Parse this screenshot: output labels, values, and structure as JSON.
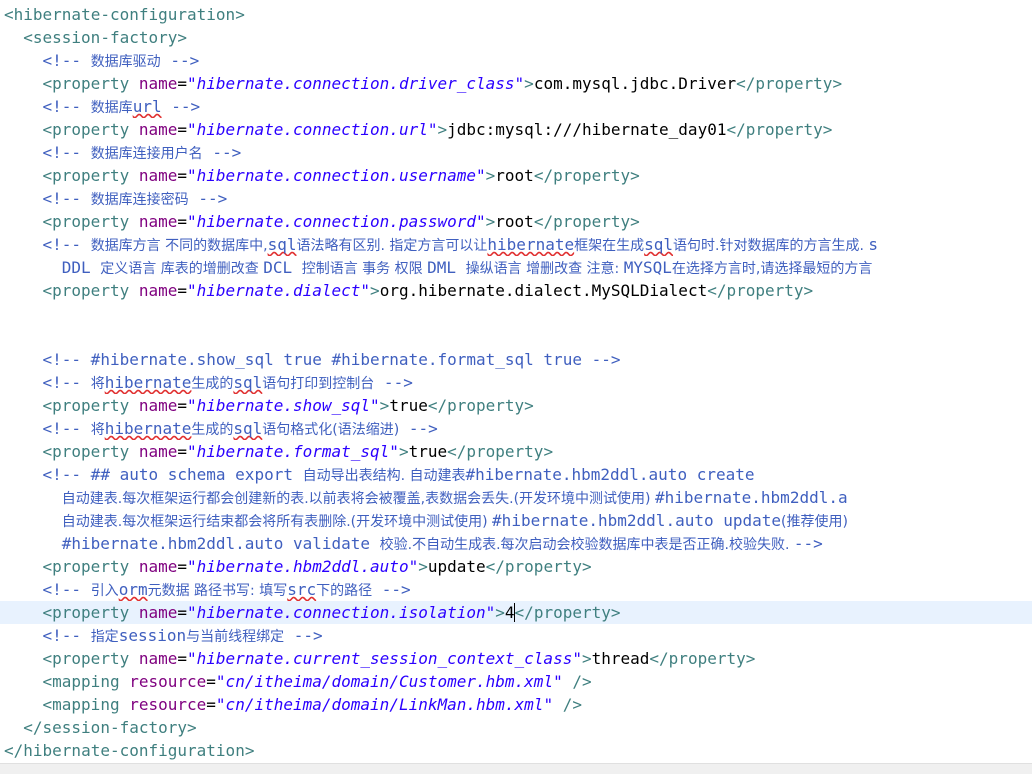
{
  "lines": [
    {
      "indent": 0,
      "parts": [
        {
          "c": "t",
          "x": "<hibernate-configuration>"
        }
      ]
    },
    {
      "indent": 2,
      "parts": [
        {
          "c": "t",
          "x": "<session-factory>"
        }
      ]
    },
    {
      "indent": 4,
      "parts": [
        {
          "c": "c",
          "x": "<!-- "
        },
        {
          "c": "c cz",
          "x": "数据库驱动"
        },
        {
          "c": "c",
          "x": " -->"
        }
      ]
    },
    {
      "indent": 4,
      "parts": [
        {
          "c": "t",
          "x": "<property "
        },
        {
          "c": "a",
          "x": "name"
        },
        {
          "c": "",
          "x": "="
        },
        {
          "c": "v",
          "x": "\"hibernate.connection.driver_class\""
        },
        {
          "c": "t",
          "x": ">"
        },
        {
          "c": "",
          "x": "com.mysql.jdbc.Driver"
        },
        {
          "c": "t",
          "x": "</property>"
        }
      ]
    },
    {
      "indent": 4,
      "parts": [
        {
          "c": "c",
          "x": "<!-- "
        },
        {
          "c": "c cz",
          "x": "数据库"
        },
        {
          "c": "c sq",
          "x": "url"
        },
        {
          "c": "c",
          "x": " -->"
        }
      ]
    },
    {
      "indent": 4,
      "parts": [
        {
          "c": "t",
          "x": "<property "
        },
        {
          "c": "a",
          "x": "name"
        },
        {
          "c": "",
          "x": "="
        },
        {
          "c": "v",
          "x": "\"hibernate.connection.url\""
        },
        {
          "c": "t",
          "x": ">"
        },
        {
          "c": "",
          "x": "jdbc:mysql:///hibernate_day01"
        },
        {
          "c": "t",
          "x": "</property>"
        }
      ]
    },
    {
      "indent": 4,
      "parts": [
        {
          "c": "c",
          "x": "<!-- "
        },
        {
          "c": "c cz",
          "x": "数据库连接用户名"
        },
        {
          "c": "c",
          "x": " -->"
        }
      ]
    },
    {
      "indent": 4,
      "parts": [
        {
          "c": "t",
          "x": "<property "
        },
        {
          "c": "a",
          "x": "name"
        },
        {
          "c": "",
          "x": "="
        },
        {
          "c": "v",
          "x": "\"hibernate.connection.username\""
        },
        {
          "c": "t",
          "x": ">"
        },
        {
          "c": "",
          "x": "root"
        },
        {
          "c": "t",
          "x": "</property>"
        }
      ]
    },
    {
      "indent": 4,
      "parts": [
        {
          "c": "c",
          "x": "<!-- "
        },
        {
          "c": "c cz",
          "x": "数据库连接密码"
        },
        {
          "c": "c",
          "x": " -->"
        }
      ]
    },
    {
      "indent": 4,
      "parts": [
        {
          "c": "t",
          "x": "<property "
        },
        {
          "c": "a",
          "x": "name"
        },
        {
          "c": "",
          "x": "="
        },
        {
          "c": "v",
          "x": "\"hibernate.connection.password\""
        },
        {
          "c": "t",
          "x": ">"
        },
        {
          "c": "",
          "x": "root"
        },
        {
          "c": "t",
          "x": "</property>"
        }
      ]
    },
    {
      "indent": 4,
      "parts": [
        {
          "c": "c",
          "x": "<!-- "
        },
        {
          "c": "c cz",
          "x": "数据库方言 不同的数据库中,"
        },
        {
          "c": "c sq",
          "x": "sql"
        },
        {
          "c": "c cz",
          "x": "语法略有区别. 指定方言可以让"
        },
        {
          "c": "c sq",
          "x": "hibernate"
        },
        {
          "c": "c cz",
          "x": "框架在生成"
        },
        {
          "c": "c sq",
          "x": "sql"
        },
        {
          "c": "c cz",
          "x": "语句时.针对数据库的方言生成. "
        },
        {
          "c": "c",
          "x": "s"
        }
      ]
    },
    {
      "indent": 6,
      "parts": [
        {
          "c": "c",
          "x": "DDL "
        },
        {
          "c": "c cz",
          "x": "定义语言 库表的增删改查 "
        },
        {
          "c": "c",
          "x": "DCL "
        },
        {
          "c": "c cz",
          "x": "控制语言 事务 权限 "
        },
        {
          "c": "c",
          "x": "DML "
        },
        {
          "c": "c cz",
          "x": "操纵语言 增删改查 注意: "
        },
        {
          "c": "c",
          "x": "MYSQL"
        },
        {
          "c": "c cz",
          "x": "在选择方言时,请选择最短的方言"
        }
      ]
    },
    {
      "indent": 4,
      "parts": [
        {
          "c": "t",
          "x": "<property "
        },
        {
          "c": "a",
          "x": "name"
        },
        {
          "c": "",
          "x": "="
        },
        {
          "c": "v",
          "x": "\"hibernate.dialect\""
        },
        {
          "c": "t",
          "x": ">"
        },
        {
          "c": "",
          "x": "org.hibernate.dialect.MySQLDialect"
        },
        {
          "c": "t",
          "x": "</property>"
        }
      ]
    },
    {
      "indent": 0,
      "parts": []
    },
    {
      "indent": 0,
      "parts": []
    },
    {
      "indent": 4,
      "parts": [
        {
          "c": "c",
          "x": "<!-- #hibernate.show_sql true #hibernate.format_sql true -->"
        }
      ]
    },
    {
      "indent": 4,
      "parts": [
        {
          "c": "c",
          "x": "<!-- "
        },
        {
          "c": "c cz",
          "x": "将"
        },
        {
          "c": "c sq",
          "x": "hibernate"
        },
        {
          "c": "c cz",
          "x": "生成的"
        },
        {
          "c": "c sq",
          "x": "sql"
        },
        {
          "c": "c cz",
          "x": "语句打印到控制台"
        },
        {
          "c": "c",
          "x": " -->"
        }
      ]
    },
    {
      "indent": 4,
      "parts": [
        {
          "c": "t",
          "x": "<property "
        },
        {
          "c": "a",
          "x": "name"
        },
        {
          "c": "",
          "x": "="
        },
        {
          "c": "v",
          "x": "\"hibernate.show_sql\""
        },
        {
          "c": "t",
          "x": ">"
        },
        {
          "c": "",
          "x": "true"
        },
        {
          "c": "t",
          "x": "</property>"
        }
      ]
    },
    {
      "indent": 4,
      "parts": [
        {
          "c": "c",
          "x": "<!-- "
        },
        {
          "c": "c cz",
          "x": "将"
        },
        {
          "c": "c sq",
          "x": "hibernate"
        },
        {
          "c": "c cz",
          "x": "生成的"
        },
        {
          "c": "c sq",
          "x": "sql"
        },
        {
          "c": "c cz",
          "x": "语句格式化(语法缩进)"
        },
        {
          "c": "c",
          "x": " -->"
        }
      ]
    },
    {
      "indent": 4,
      "parts": [
        {
          "c": "t",
          "x": "<property "
        },
        {
          "c": "a",
          "x": "name"
        },
        {
          "c": "",
          "x": "="
        },
        {
          "c": "v",
          "x": "\"hibernate.format_sql\""
        },
        {
          "c": "t",
          "x": ">"
        },
        {
          "c": "",
          "x": "true"
        },
        {
          "c": "t",
          "x": "</property>"
        }
      ]
    },
    {
      "indent": 4,
      "parts": [
        {
          "c": "c",
          "x": "<!-- ## auto schema export "
        },
        {
          "c": "c cz",
          "x": "自动导出表结构. 自动建表"
        },
        {
          "c": "c",
          "x": "#hibernate.hbm2ddl.auto create"
        }
      ]
    },
    {
      "indent": 6,
      "parts": [
        {
          "c": "c cz",
          "x": "自动建表.每次框架运行都会创建新的表.以前表将会被覆盖,表数据会丢失.(开发环境中测试使用) "
        },
        {
          "c": "c",
          "x": "#hibernate.hbm2ddl.a"
        }
      ]
    },
    {
      "indent": 6,
      "parts": [
        {
          "c": "c cz",
          "x": "自动建表.每次框架运行结束都会将所有表删除.(开发环境中测试使用) "
        },
        {
          "c": "c",
          "x": "#hibernate.hbm2ddl.auto update"
        },
        {
          "c": "c cz",
          "x": "(推荐使用)"
        }
      ]
    },
    {
      "indent": 6,
      "parts": [
        {
          "c": "c",
          "x": "#hibernate.hbm2ddl.auto validate "
        },
        {
          "c": "c cz",
          "x": "校验.不自动生成表.每次启动会校验数据库中表是否正确.校验失败. "
        },
        {
          "c": "c",
          "x": "-->"
        }
      ]
    },
    {
      "indent": 4,
      "parts": [
        {
          "c": "t",
          "x": "<property "
        },
        {
          "c": "a",
          "x": "name"
        },
        {
          "c": "",
          "x": "="
        },
        {
          "c": "v",
          "x": "\"hibernate.hbm2ddl.auto\""
        },
        {
          "c": "t",
          "x": ">"
        },
        {
          "c": "",
          "x": "update"
        },
        {
          "c": "t",
          "x": "</property>"
        }
      ]
    },
    {
      "indent": 4,
      "parts": [
        {
          "c": "c",
          "x": "<!-- "
        },
        {
          "c": "c cz",
          "x": "引入"
        },
        {
          "c": "c sq",
          "x": "orm"
        },
        {
          "c": "c cz",
          "x": "元数据 路径书写: 填写"
        },
        {
          "c": "c sq",
          "x": "src"
        },
        {
          "c": "c cz",
          "x": "下的路径"
        },
        {
          "c": "c",
          "x": " -->"
        }
      ]
    },
    {
      "indent": 4,
      "current": true,
      "parts": [
        {
          "c": "t",
          "x": "<property "
        },
        {
          "c": "a",
          "x": "name"
        },
        {
          "c": "",
          "x": "="
        },
        {
          "c": "v",
          "x": "\"hibernate.connection.isolation\""
        },
        {
          "c": "t",
          "x": ">"
        },
        {
          "c": "",
          "x": "4"
        },
        {
          "c": "t caret",
          "x": "</property>"
        }
      ]
    },
    {
      "indent": 4,
      "parts": [
        {
          "c": "c",
          "x": "<!-- "
        },
        {
          "c": "c cz",
          "x": "指定"
        },
        {
          "c": "c",
          "x": "session"
        },
        {
          "c": "c cz",
          "x": "与当前线程绑定"
        },
        {
          "c": "c",
          "x": " -->"
        }
      ]
    },
    {
      "indent": 4,
      "parts": [
        {
          "c": "t",
          "x": "<property "
        },
        {
          "c": "a",
          "x": "name"
        },
        {
          "c": "",
          "x": "="
        },
        {
          "c": "v",
          "x": "\"hibernate.current_session_context_class\""
        },
        {
          "c": "t",
          "x": ">"
        },
        {
          "c": "",
          "x": "thread"
        },
        {
          "c": "t",
          "x": "</property>"
        }
      ]
    },
    {
      "indent": 4,
      "parts": [
        {
          "c": "t",
          "x": "<mapping "
        },
        {
          "c": "a",
          "x": "resource"
        },
        {
          "c": "",
          "x": "="
        },
        {
          "c": "v",
          "x": "\"cn/itheima/domain/Customer.hbm.xml\""
        },
        {
          "c": "t",
          "x": " />"
        }
      ]
    },
    {
      "indent": 4,
      "parts": [
        {
          "c": "t",
          "x": "<mapping "
        },
        {
          "c": "a",
          "x": "resource"
        },
        {
          "c": "",
          "x": "="
        },
        {
          "c": "v",
          "x": "\"cn/itheima/domain/LinkMan.hbm.xml\""
        },
        {
          "c": "t",
          "x": " />"
        }
      ]
    },
    {
      "indent": 2,
      "parts": [
        {
          "c": "t",
          "x": "</session-factory>"
        }
      ]
    },
    {
      "indent": 0,
      "parts": [
        {
          "c": "t",
          "x": "</hibernate-configuration>"
        }
      ]
    }
  ]
}
